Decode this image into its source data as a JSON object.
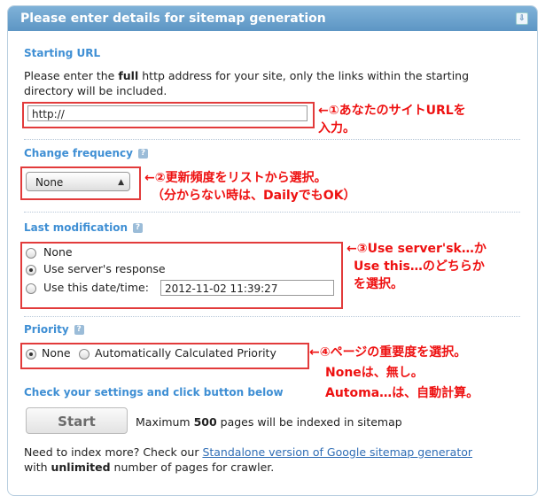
{
  "header": {
    "title": "Please enter details for sitemap generation",
    "expand_icon": "⇩"
  },
  "starting_url": {
    "title": "Starting URL",
    "desc_pre": "Please enter the ",
    "desc_bold": "full",
    "desc_post": " http address for your site, only the links within the starting",
    "desc_line2": "directory will be included.",
    "value": "http://",
    "note_line1": "←①あなたのサイトURLを",
    "note_line2": "入力。"
  },
  "change_frequency": {
    "title": "Change frequency",
    "help": "?",
    "selected": "None",
    "note_line1": "←②更新頻度をリストから選択。",
    "note_line2": "（分からない時は、DailyでもOK）"
  },
  "last_modification": {
    "title": "Last modification",
    "help": "?",
    "opt_none": "None",
    "opt_server": "Use server's response",
    "opt_date": "Use this date/time:",
    "date_value": "2012-11-02 11:39:27",
    "note_line1": "←③Use server'sk…か",
    "note_line2": "Use this…のどちらか",
    "note_line3": "を選択。"
  },
  "priority": {
    "title": "Priority",
    "help": "?",
    "opt_none": "None",
    "opt_auto": "Automatically Calculated Priority",
    "note_line1": "←④ページの重要度を選択。",
    "note_line2": "Noneは、無し。",
    "note_line3": "Automa…は、自動計算。"
  },
  "start": {
    "title": "Check your settings and click button below",
    "button": "Start",
    "max_pre": "Maximum ",
    "max_bold": "500",
    "max_post": " pages will be indexed in sitemap"
  },
  "footer": {
    "line1_pre": "Need to index more? Check our ",
    "link": "Standalone version of Google sitemap generator",
    "line2_pre": "with ",
    "line2_bold": "unlimited",
    "line2_post": " number of pages for crawler."
  },
  "colors": {
    "accent": "#3f8fd4",
    "annotation": "#e11111",
    "header": "#6aa2cd"
  }
}
